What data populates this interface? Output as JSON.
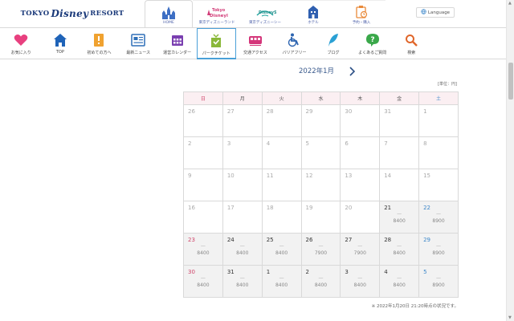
{
  "header": {
    "logo": {
      "left": "TOKYO",
      "script": "Disney",
      "right": "RESORT"
    },
    "park_tabs": [
      {
        "label": "HOME",
        "icon": "castle-icon",
        "active": true
      },
      {
        "label": "東京ディズニーランド",
        "icon": "tokyo-disneyland-logo-icon",
        "active": false
      },
      {
        "label": "東京ディズニーシー",
        "icon": "tokyo-disneysea-logo-icon",
        "active": false
      },
      {
        "label": "ホテル",
        "icon": "hotel-icon",
        "active": false
      },
      {
        "label": "予約・購入",
        "icon": "reservation-icon",
        "active": false
      }
    ],
    "language_label": "Language"
  },
  "nav": [
    {
      "label": "お気に入り",
      "icon": "heart-icon"
    },
    {
      "label": "TOP",
      "icon": "home-icon"
    },
    {
      "label": "初めての方へ",
      "icon": "beginner-icon"
    },
    {
      "label": "最新ニュース",
      "icon": "news-icon"
    },
    {
      "label": "運営カレンダー",
      "icon": "calendar-icon"
    },
    {
      "label": "パークチケット",
      "icon": "ticket-icon"
    },
    {
      "label": "交通アクセス",
      "icon": "train-icon"
    },
    {
      "label": "バリアフリー",
      "icon": "wheelchair-icon"
    },
    {
      "label": "ブログ",
      "icon": "feather-icon"
    },
    {
      "label": "よくあるご質問",
      "icon": "question-icon"
    },
    {
      "label": "検索",
      "icon": "search-icon"
    }
  ],
  "calendar": {
    "month_title": "2022年1月",
    "unit_label": "[単位：円]",
    "weekdays": [
      "日",
      "月",
      "火",
      "水",
      "木",
      "金",
      "土"
    ],
    "weeks": [
      [
        {
          "day": "26"
        },
        {
          "day": "27"
        },
        {
          "day": "28"
        },
        {
          "day": "29"
        },
        {
          "day": "30"
        },
        {
          "day": "31"
        },
        {
          "day": "1"
        }
      ],
      [
        {
          "day": "2"
        },
        {
          "day": "3"
        },
        {
          "day": "4"
        },
        {
          "day": "5"
        },
        {
          "day": "6"
        },
        {
          "day": "7"
        },
        {
          "day": "8"
        }
      ],
      [
        {
          "day": "9"
        },
        {
          "day": "10"
        },
        {
          "day": "11"
        },
        {
          "day": "12"
        },
        {
          "day": "13"
        },
        {
          "day": "14"
        },
        {
          "day": "15"
        }
      ],
      [
        {
          "day": "16"
        },
        {
          "day": "17"
        },
        {
          "day": "18"
        },
        {
          "day": "19"
        },
        {
          "day": "20"
        },
        {
          "day": "21",
          "avail": true,
          "dash": "—",
          "price": "8400"
        },
        {
          "day": "22",
          "avail": true,
          "dash": "—",
          "price": "8900"
        }
      ],
      [
        {
          "day": "23",
          "avail": true,
          "dash": "—",
          "price": "8400"
        },
        {
          "day": "24",
          "avail": true,
          "dash": "—",
          "price": "8400"
        },
        {
          "day": "25",
          "avail": true,
          "dash": "—",
          "price": "8400"
        },
        {
          "day": "26",
          "avail": true,
          "dash": "—",
          "price": "7900"
        },
        {
          "day": "27",
          "avail": true,
          "dash": "—",
          "price": "7900"
        },
        {
          "day": "28",
          "avail": true,
          "dash": "—",
          "price": "8400"
        },
        {
          "day": "29",
          "avail": true,
          "dash": "—",
          "price": "8900"
        }
      ],
      [
        {
          "day": "30",
          "avail": true,
          "dash": "—",
          "price": "8400"
        },
        {
          "day": "31",
          "avail": true,
          "dash": "—",
          "price": "8400"
        },
        {
          "day": "1",
          "avail": true,
          "dash": "—",
          "price": "8400"
        },
        {
          "day": "2",
          "avail": true,
          "dash": "—",
          "price": "8400"
        },
        {
          "day": "3",
          "avail": true,
          "dash": "—",
          "price": "8400"
        },
        {
          "day": "4",
          "avail": true,
          "dash": "—",
          "price": "8400"
        },
        {
          "day": "5",
          "avail": true,
          "dash": "—",
          "price": "8900"
        }
      ]
    ],
    "note": "※ 2022年1月20日 21:20時点の状況です。"
  },
  "colors": {
    "sunday": "#d0456a",
    "saturday": "#3b86c9",
    "header_bg": "#fbeff2",
    "available_bg": "#f2f2f2",
    "active_nav_border": "#4aa0d8"
  }
}
